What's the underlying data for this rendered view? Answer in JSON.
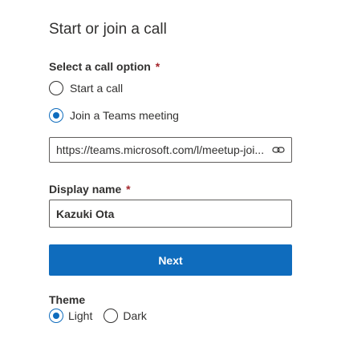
{
  "dialog": {
    "title": "Start or join a call"
  },
  "call_option": {
    "label": "Select a call option",
    "required_mark": "*",
    "options": [
      {
        "label": "Start a call",
        "selected": false
      },
      {
        "label": "Join a Teams meeting",
        "selected": true
      }
    ]
  },
  "meeting_link": {
    "value": "https://teams.microsoft.com/l/meetup-joi...",
    "icon": "link-icon"
  },
  "display_name": {
    "label": "Display name",
    "required_mark": "*",
    "value": "Kazuki Ota"
  },
  "next_button": {
    "label": "Next"
  },
  "theme": {
    "label": "Theme",
    "options": [
      {
        "label": "Light",
        "selected": true
      },
      {
        "label": "Dark",
        "selected": false
      }
    ]
  },
  "colors": {
    "accent": "#0f6cbd",
    "required": "#a4262c",
    "text": "#323130"
  }
}
